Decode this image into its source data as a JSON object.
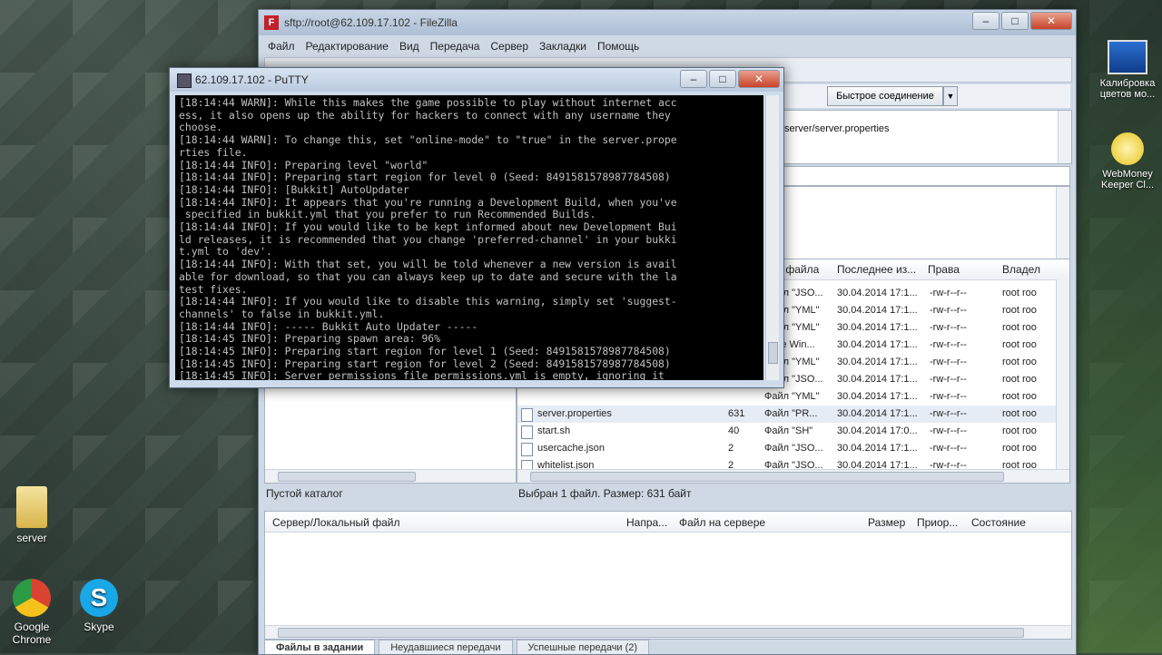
{
  "desktop": {
    "icons": [
      {
        "label": "server"
      },
      {
        "label": "Google Chrome"
      },
      {
        "label": "Skype"
      },
      {
        "label": "Калибровка цветов мо..."
      },
      {
        "label": "WebMoney Keeper Cl..."
      }
    ]
  },
  "filezilla": {
    "title": "sftp://root@62.109.17.102 - FileZilla",
    "menu": [
      "Файл",
      "Редактирование",
      "Вид",
      "Передача",
      "Сервер",
      "Закладки",
      "Помощь"
    ],
    "quickconnect_label": "Быстрое соединение",
    "log_text": "server/server.properties",
    "remote_files": {
      "headers": [
        "Тип файла",
        "Последнее из...",
        "Права",
        "Владел"
      ],
      "rows": [
        {
          "name": "",
          "size": "",
          "type": "Файл \"JSO...",
          "modified": "30.04.2014 17:1...",
          "perms": "-rw-r--r--",
          "owner": "root roo"
        },
        {
          "name": "",
          "size": "",
          "type": "Файл \"YML\"",
          "modified": "30.04.2014 17:1...",
          "perms": "-rw-r--r--",
          "owner": "root roo"
        },
        {
          "name": "",
          "size": "",
          "type": "Файл \"YML\"",
          "modified": "30.04.2014 17:1...",
          "perms": "-rw-r--r--",
          "owner": "root roo"
        },
        {
          "name": "",
          "size": "",
          "type": "ание Win...",
          "modified": "30.04.2014 17:1...",
          "perms": "-rw-r--r--",
          "owner": "root roo"
        },
        {
          "name": "",
          "size": "",
          "type": "Файл \"YML\"",
          "modified": "30.04.2014 17:1...",
          "perms": "-rw-r--r--",
          "owner": "root roo"
        },
        {
          "name": "",
          "size": "",
          "type": "Файл \"JSO...",
          "modified": "30.04.2014 17:1...",
          "perms": "-rw-r--r--",
          "owner": "root roo"
        },
        {
          "name": "",
          "size": "",
          "type": "Файл \"YML\"",
          "modified": "30.04.2014 17:1...",
          "perms": "-rw-r--r--",
          "owner": "root roo"
        },
        {
          "name": "server.properties",
          "size": "631",
          "type": "Файл \"PR...",
          "modified": "30.04.2014 17:1...",
          "perms": "-rw-r--r--",
          "owner": "root roo"
        },
        {
          "name": "start.sh",
          "size": "40",
          "type": "Файл \"SH\"",
          "modified": "30.04.2014 17:0...",
          "perms": "-rw-r--r--",
          "owner": "root roo"
        },
        {
          "name": "usercache.json",
          "size": "2",
          "type": "Файл \"JSO...",
          "modified": "30.04.2014 17:1...",
          "perms": "-rw-r--r--",
          "owner": "root roo"
        },
        {
          "name": "whitelist.json",
          "size": "2",
          "type": "Файл \"JSO...",
          "modified": "30.04.2014 17:1...",
          "perms": "-rw-r--r--",
          "owner": "root roo"
        }
      ]
    },
    "local_status": "Пустой каталог",
    "remote_status": "Выбран 1 файл. Размер: 631 байт",
    "queue_headers": [
      "Сервер/Локальный файл",
      "Напра...",
      "Файл на сервере",
      "Размер",
      "Приор...",
      "Состояние"
    ],
    "tabs": [
      "Файлы в задании",
      "Неудавшиеся передачи",
      "Успешные передачи (2)"
    ]
  },
  "putty": {
    "title": "62.109.17.102 - PuTTY",
    "lines": [
      "[18:14:44 WARN]: While this makes the game possible to play without internet acc",
      "ess, it also opens up the ability for hackers to connect with any username they",
      "choose.",
      "[18:14:44 WARN]: To change this, set \"online-mode\" to \"true\" in the server.prope",
      "rties file.",
      "[18:14:44 INFO]: Preparing level \"world\"",
      "[18:14:44 INFO]: Preparing start region for level 0 (Seed: 8491581578987784508)",
      "[18:14:44 INFO]: [Bukkit] AutoUpdater",
      "[18:14:44 INFO]: It appears that you're running a Development Build, when you've",
      " specified in bukkit.yml that you prefer to run Recommended Builds.",
      "[18:14:44 INFO]: If you would like to be kept informed about new Development Bui",
      "ld releases, it is recommended that you change 'preferred-channel' in your bukki",
      "t.yml to 'dev'.",
      "[18:14:44 INFO]: With that set, you will be told whenever a new version is avail",
      "able for download, so that you can always keep up to date and secure with the la",
      "test fixes.",
      "[18:14:44 INFO]: If you would like to disable this warning, simply set 'suggest-",
      "channels' to false in bukkit.yml.",
      "[18:14:44 INFO]: ----- Bukkit Auto Updater -----",
      "[18:14:45 INFO]: Preparing spawn area: 96%",
      "[18:14:45 INFO]: Preparing start region for level 1 (Seed: 8491581578987784508)",
      "[18:14:45 INFO]: Preparing start region for level 2 (Seed: 8491581578987784508)",
      "[18:14:45 INFO]: Server permissions file permissions.yml is empty, ignoring it",
      ">"
    ]
  }
}
